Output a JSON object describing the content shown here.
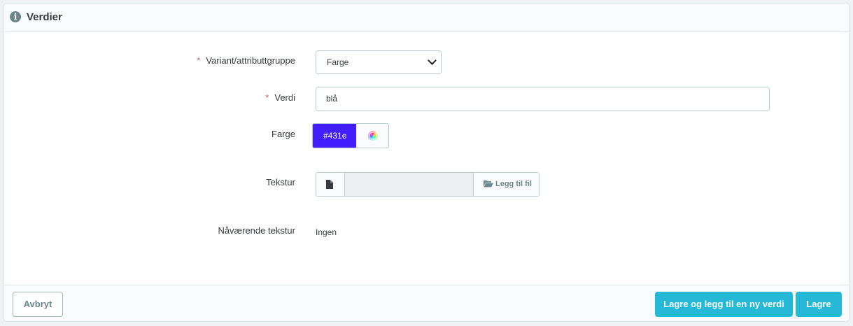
{
  "panel": {
    "title": "Verdier",
    "icon": "info-icon"
  },
  "form": {
    "attribute_group": {
      "label": "Variant/attributtgruppe",
      "required": true,
      "selected": "Farge"
    },
    "value": {
      "label": "Verdi",
      "required": true,
      "value": "blå"
    },
    "color": {
      "label": "Farge",
      "value": "#431e",
      "swatch_hex": "#431eff",
      "picker_icon": "color-wheel-icon"
    },
    "texture": {
      "label": "Tekstur",
      "file_icon": "file-icon",
      "button_label": "Legg til fil",
      "button_icon": "folder-open-icon"
    },
    "current_texture": {
      "label": "Nåværende tekstur",
      "value": "Ingen"
    }
  },
  "footer": {
    "cancel_label": "Avbryt",
    "save_add_label": "Lagre og legg til en ny verdi",
    "save_label": "Lagre"
  },
  "colors": {
    "primary": "#25b9d7",
    "required_star": "#c05c67"
  }
}
